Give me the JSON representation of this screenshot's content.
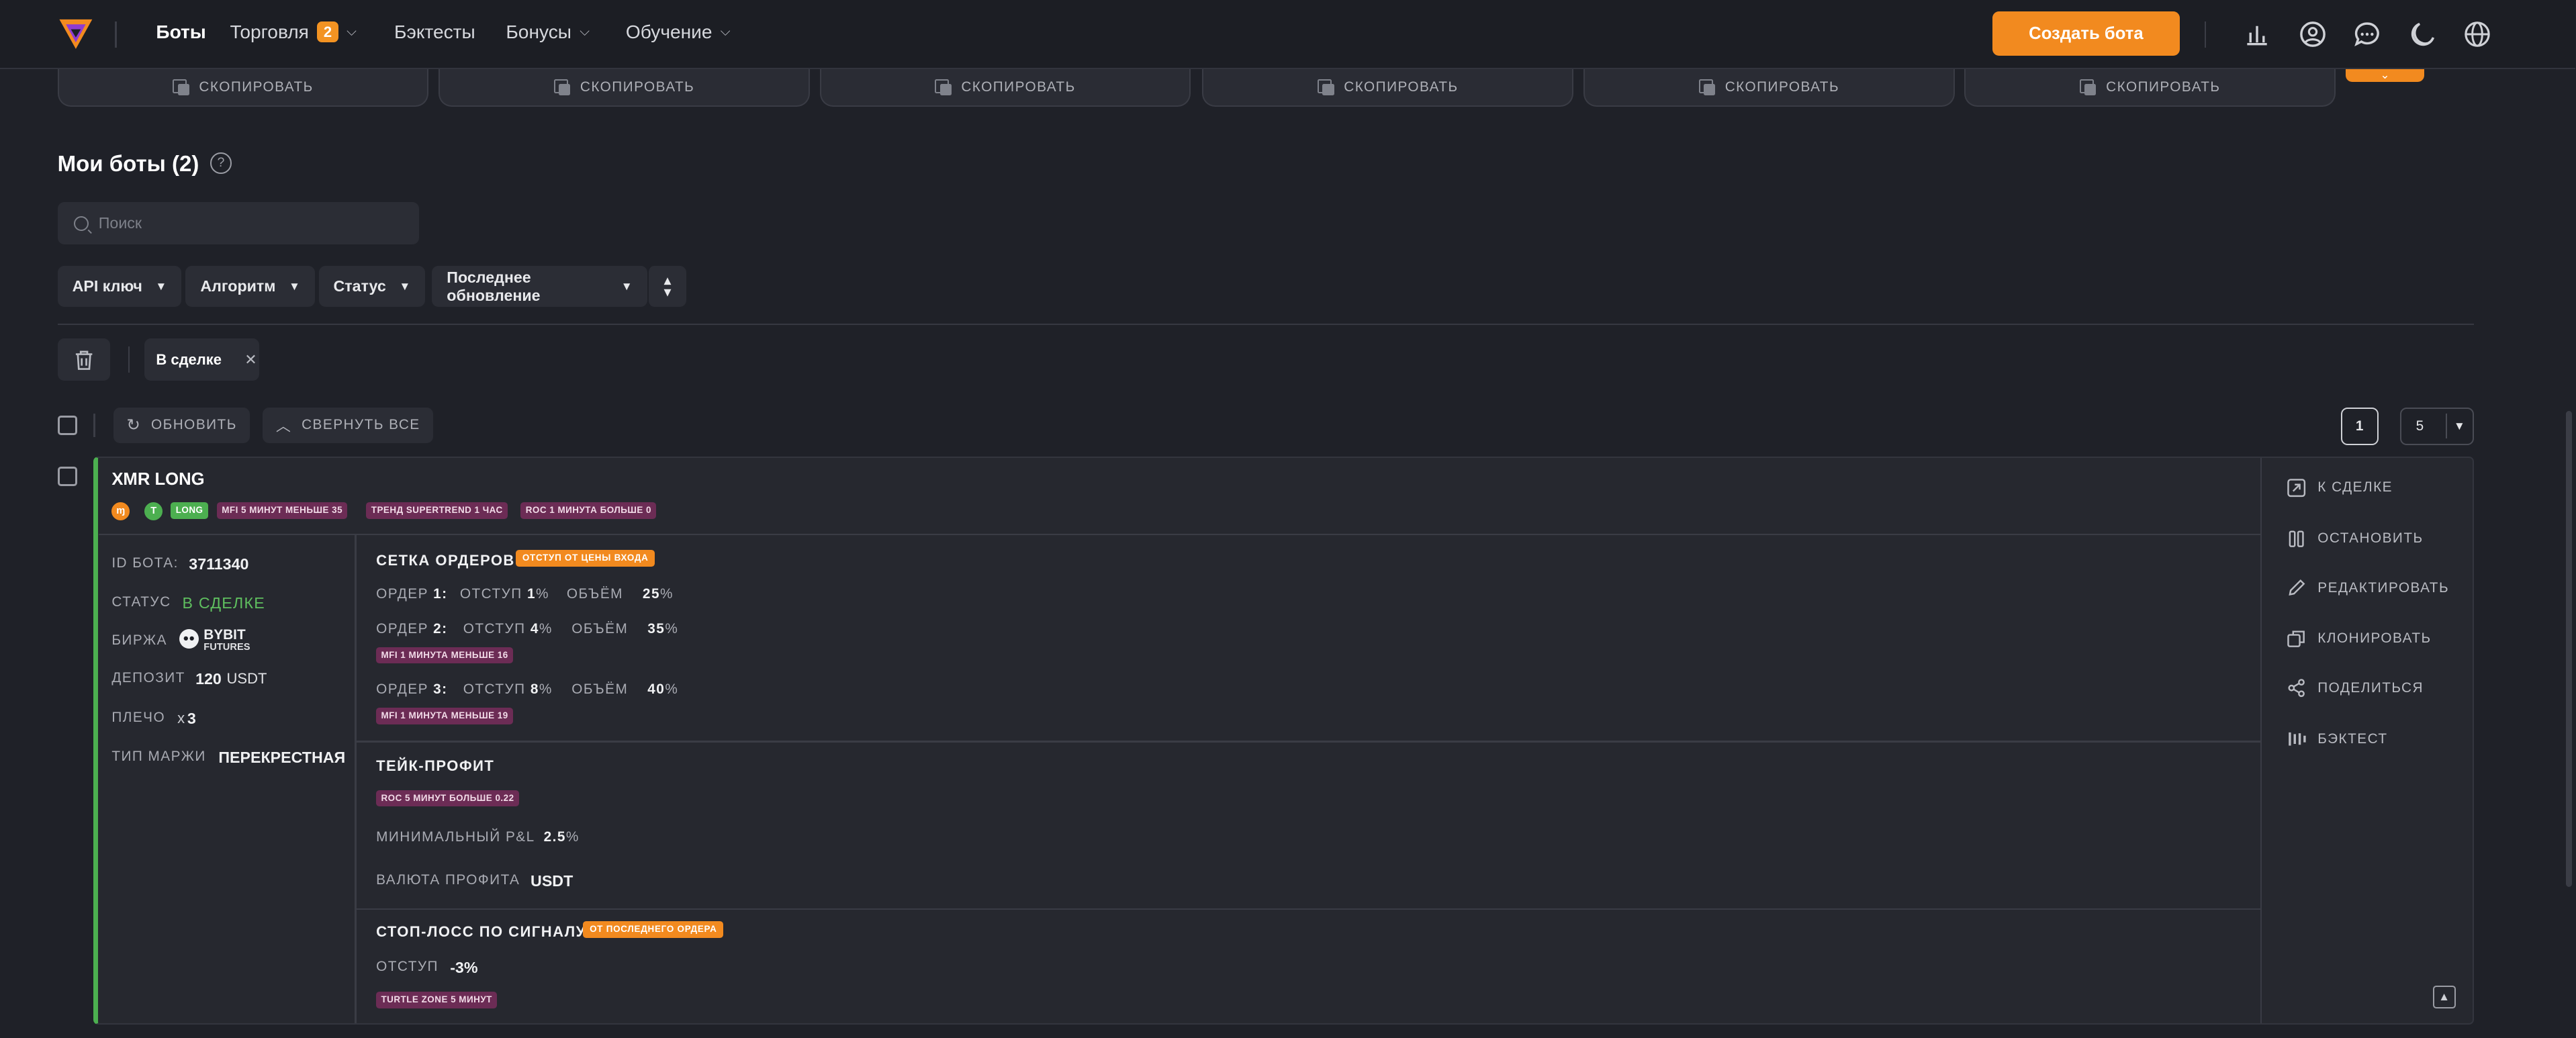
{
  "header": {
    "nav": [
      {
        "label": "Боты",
        "active": true
      },
      {
        "label": "Торговля",
        "badge": "2",
        "dropdown": true
      },
      {
        "label": "Бэктесты"
      },
      {
        "label": "Бонусы",
        "dropdown": true
      },
      {
        "label": "Обучение",
        "dropdown": true
      }
    ],
    "create_label": "Создать бота",
    "icons": [
      "chart-icon",
      "profile-icon",
      "chat-icon",
      "moon-icon",
      "globe-icon"
    ]
  },
  "copy_cards": [
    "СКОПИРОВАТЬ",
    "СКОПИРОВАТЬ",
    "СКОПИРОВАТЬ",
    "СКОПИРОВАТЬ",
    "СКОПИРОВАТЬ",
    "СКОПИРОВАТЬ"
  ],
  "section": {
    "title": "Мои боты (2)",
    "help": "?"
  },
  "search": {
    "placeholder": "Поиск"
  },
  "filters": [
    "API ключ",
    "Алгоритм",
    "Статус",
    "Последнее обновление"
  ],
  "active_filter": "В сделке",
  "toolbar": {
    "refresh": "ОБНОВИТЬ",
    "collapse": "СВЕРНУТЬ ВСЕ",
    "page": "1",
    "per_page": "5"
  },
  "bot": {
    "name": "XMR LONG",
    "direction": "LONG",
    "tags": [
      "MFI 5 МИНУТ МЕНЬШЕ 35",
      "ТРЕНД SUPERTREND 1 ЧАС",
      "ROC 1 МИНУТА БОЛЬШЕ 0"
    ],
    "info": {
      "id_label": "ID БОТА:",
      "id": "3711340",
      "status_label": "СТАТУС",
      "status": "В СДЕЛКЕ",
      "exchange_label": "БИРЖА",
      "exchange": "BYBIT",
      "exchange_sub": "FUTURES",
      "deposit_label": "ДЕПОЗИТ",
      "deposit": "120",
      "deposit_cur": "USDT",
      "leverage_label": "ПЛЕЧО",
      "leverage_x": "x",
      "leverage": "3",
      "margin_label": "ТИП МАРЖИ",
      "margin": "ПЕРЕКРЕСТНАЯ"
    },
    "grid": {
      "title": "СЕТКА ОРДЕРОВ",
      "tag": "ОТСТУП ОТ ЦЕНЫ ВХОДА",
      "orders": [
        {
          "label": "ОРДЕР",
          "num": "1:",
          "off_label": "ОТСТУП",
          "off": "1",
          "vol_label": "ОБЪЁМ",
          "vol": "25",
          "cond": ""
        },
        {
          "label": "ОРДЕР",
          "num": "2:",
          "off_label": "ОТСТУП",
          "off": "4",
          "vol_label": "ОБЪЁМ",
          "vol": "35",
          "cond": "MFI 1 МИНУТА МЕНЬШЕ 16"
        },
        {
          "label": "ОРДЕР",
          "num": "3:",
          "off_label": "ОТСТУП",
          "off": "8",
          "vol_label": "ОБЪЁМ",
          "vol": "40",
          "cond": "MFI 1 МИНУТА МЕНЬШЕ 19"
        }
      ],
      "pct": "%"
    },
    "take_profit": {
      "title": "ТЕЙК-ПРОФИТ",
      "tag": "ROC 5 МИНУТ БОЛЬШЕ 0.22",
      "min_pnl_label": "МИНИМАЛЬНЫЙ P&L",
      "min_pnl": "2.5",
      "pct": "%",
      "currency_label": "ВАЛЮТА ПРОФИТА",
      "currency": "USDT"
    },
    "stop_loss": {
      "title": "СТОП-ЛОСС ПО СИГНАЛУ",
      "tag": "ОТ ПОСЛЕДНЕГО ОРДЕРА",
      "offset_label": "ОТСТУП",
      "offset": "-3%",
      "cond": "TURTLE ZONE 5 МИНУТ"
    },
    "actions": [
      "К СДЕЛКЕ",
      "ОСТАНОВИТЬ",
      "РЕДАКТИРОВАТЬ",
      "КЛОНИРОВАТЬ",
      "ПОДЕЛИТЬСЯ",
      "БЭКТЕСТ"
    ]
  },
  "colors": {
    "accent": "#f28a1f",
    "status_green": "#5fbf5f",
    "tag_purple": "#6c2c55",
    "bg": "#1f2128"
  }
}
